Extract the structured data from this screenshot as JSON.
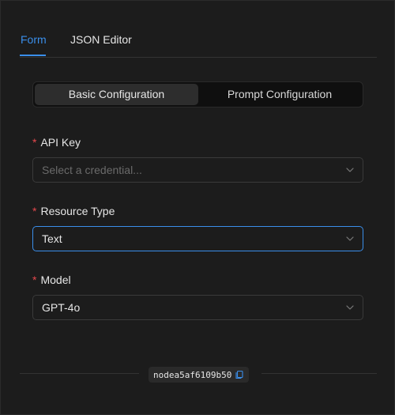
{
  "tabs": [
    {
      "label": "Form",
      "active": true
    },
    {
      "label": "JSON Editor",
      "active": false
    }
  ],
  "config_switch": {
    "basic_label": "Basic Configuration",
    "prompt_label": "Prompt Configuration",
    "selected": "Basic Configuration"
  },
  "fields": {
    "api_key": {
      "required_mark": "*",
      "label": "API Key",
      "placeholder": "Select a credential...",
      "value": ""
    },
    "resource_type": {
      "required_mark": "*",
      "label": "Resource Type",
      "value": "Text"
    },
    "model": {
      "required_mark": "*",
      "label": "Model",
      "value": "GPT-4o"
    }
  },
  "footer": {
    "node_id": "nodea5af6109b50"
  },
  "icons": {
    "chevron": "chevron-down-icon",
    "copy": "copy-icon"
  },
  "colors": {
    "accent": "#3a8eea",
    "required": "#e5484d",
    "background": "#1c1c1c"
  }
}
